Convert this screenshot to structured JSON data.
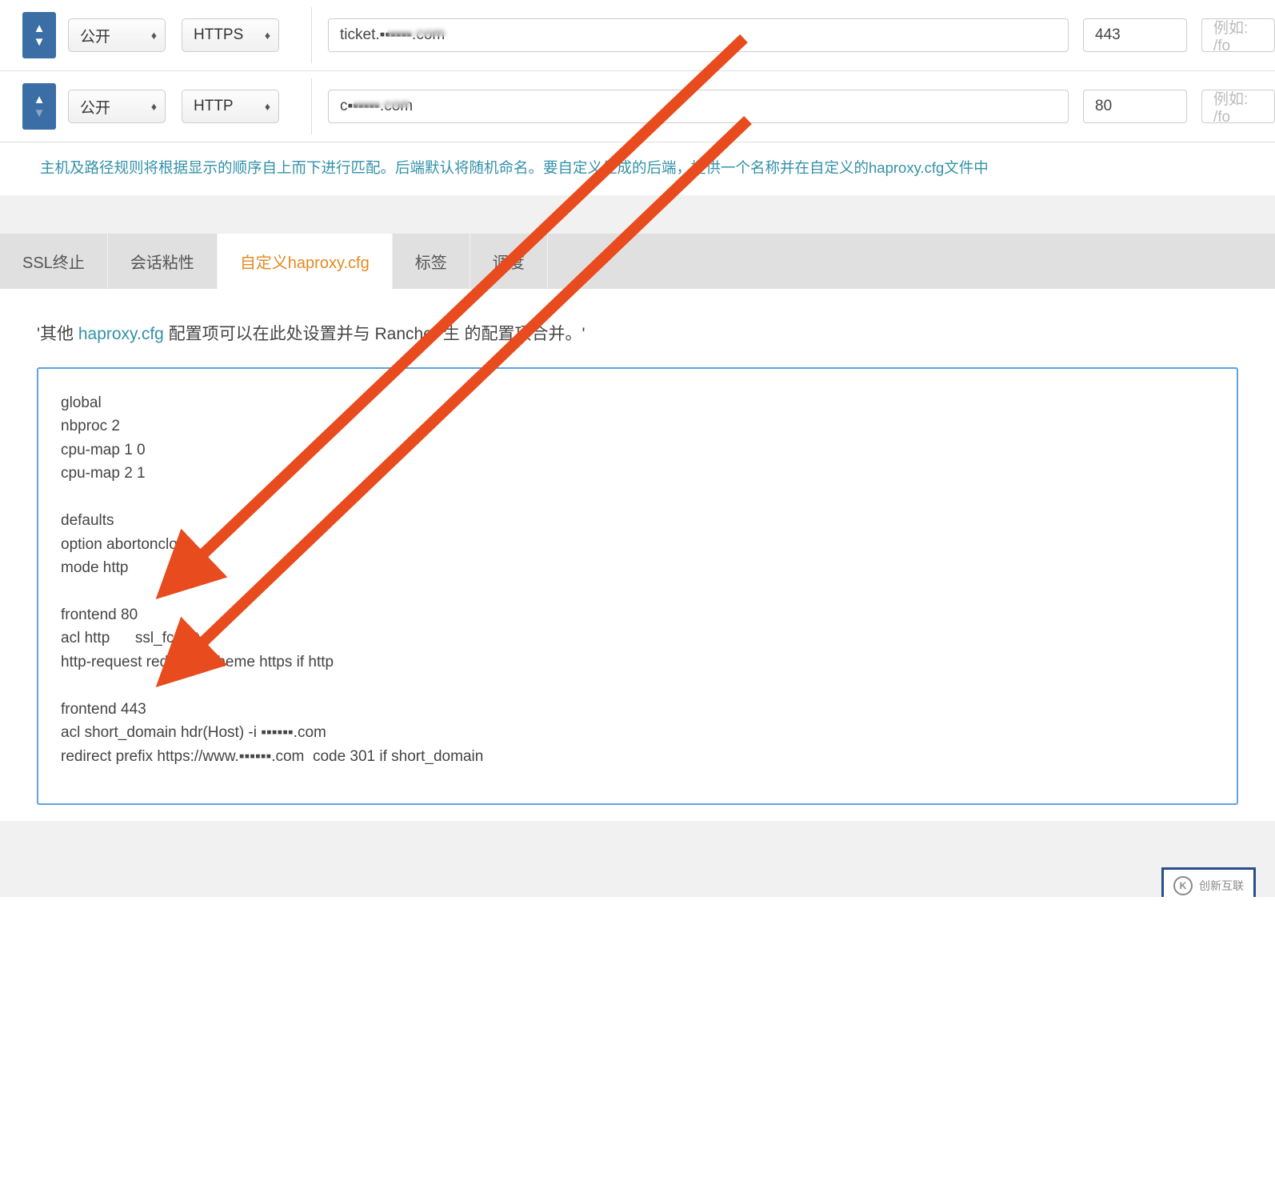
{
  "rules": [
    {
      "access": "公开",
      "protocol": "HTTPS",
      "host": "ticket.▪▪▪▪▪▪.com",
      "port": "443",
      "path_placeholder": "例如: /fo"
    },
    {
      "access": "公开",
      "protocol": "HTTP",
      "host": "c▪▪▪▪▪▪.com",
      "port": "80",
      "path_placeholder": "例如: /fo"
    }
  ],
  "hint": "主机及路径规则将根据显示的顺序自上而下进行匹配。后端默认将随机命名。要自定义生成的后端，提供一个名称并在自定义的haproxy.cfg文件中",
  "tabs": {
    "ssl": "SSL终止",
    "sticky": "会话粘性",
    "custom": "自定义haproxy.cfg",
    "label": "标签",
    "schedule": "调度"
  },
  "desc": {
    "prefix": "'其他 ",
    "link": "haproxy.cfg",
    "mid": " 配置项可以在此处设置并与 Rancher 生成的配置项合并。'",
    "mid_visible": " 配置项可以在此处设置并与 Rancher 生   的配置项合并。'"
  },
  "config": "global\nnbproc 2\ncpu-map 1 0\ncpu-map 2 1\n\ndefaults\noption abortonclose\nmode http\n\nfrontend 80\nacl http      ssl_fc,not\nhttp-request redire    scheme https if http\n\nfrontend 443\nacl short_domain hdr(Host) -i ▪▪▪▪▪▪.com\nredirect prefix https://www.▪▪▪▪▪▪.com  code 301 if short_domain",
  "logo": {
    "text": "创新互联",
    "mark": "K"
  }
}
